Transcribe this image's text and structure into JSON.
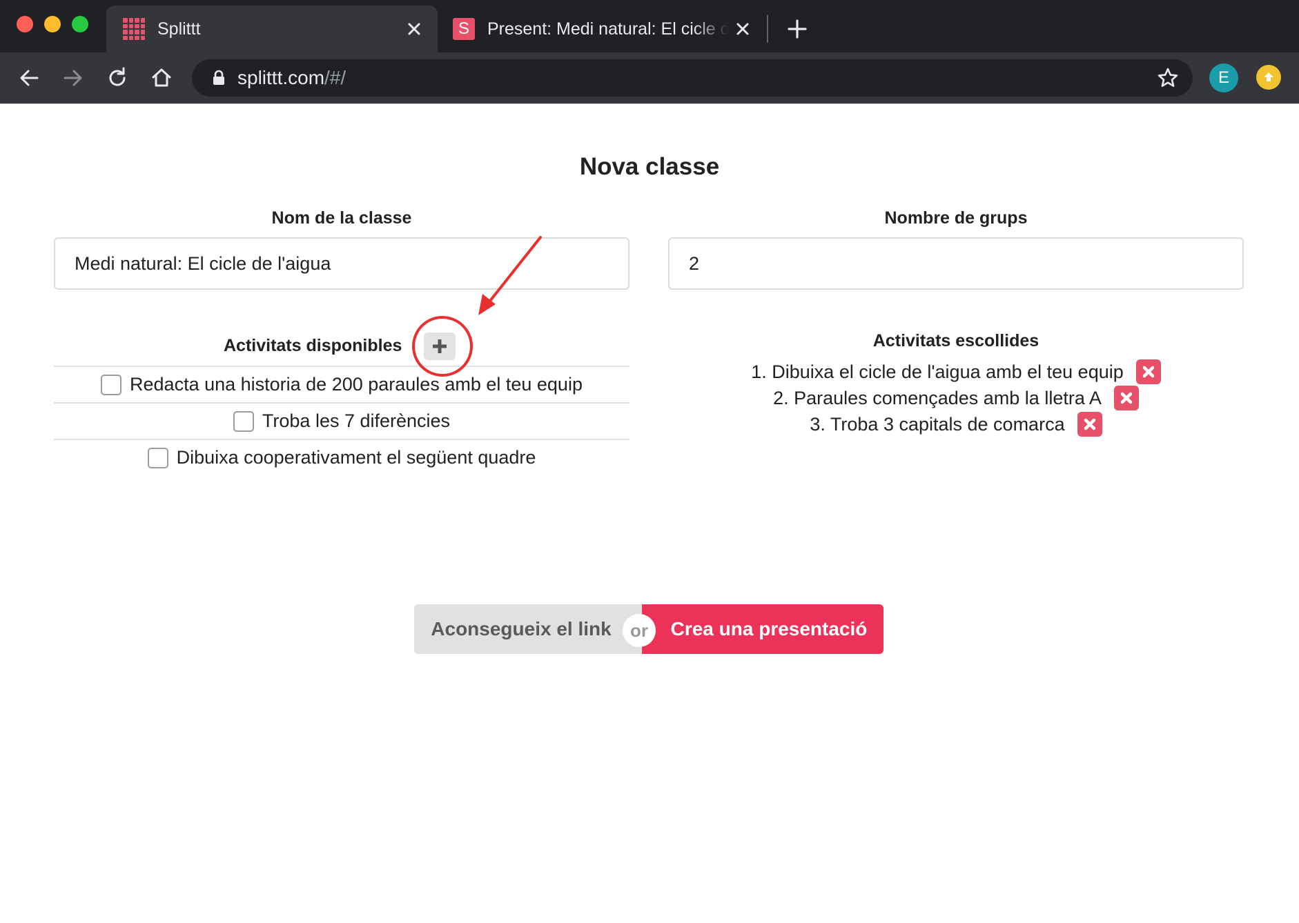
{
  "browser": {
    "tabs": [
      {
        "title": "Splittt",
        "favicon": "splittt-grid-icon",
        "active": true
      },
      {
        "title": "Present: Medi natural: El cicle de l'aigua",
        "favicon": "s-letter-icon",
        "favicon_text": "S",
        "active": false
      }
    ],
    "url_host": "splittt.com",
    "url_path": "/#/",
    "profile_initial": "E"
  },
  "page": {
    "title": "Nova classe",
    "class_name_label": "Nom de la classe",
    "class_name_value": "Medi natural: El cicle de l'aigua",
    "groups_label": "Nombre de grups",
    "groups_value": "2",
    "available_title": "Activitats disponibles",
    "available_activities": [
      "Redacta una historia de 200 paraules amb el teu equip",
      "Troba les 7 diferències",
      "Dibuixa cooperativament el següent quadre"
    ],
    "chosen_title": "Activitats escollides",
    "chosen_activities": [
      "1. Dibuixa el cicle de l'aigua amb el teu equip",
      "2. Paraules començades amb la lletra A",
      "3. Troba 3 capitals de comarca"
    ],
    "get_link_label": "Aconsegueix el link",
    "or_label": "or",
    "create_presentation_label": "Crea una presentació"
  },
  "colors": {
    "accent": "#ed3259",
    "remove": "#e8506a",
    "annotation": "#e8312f"
  }
}
